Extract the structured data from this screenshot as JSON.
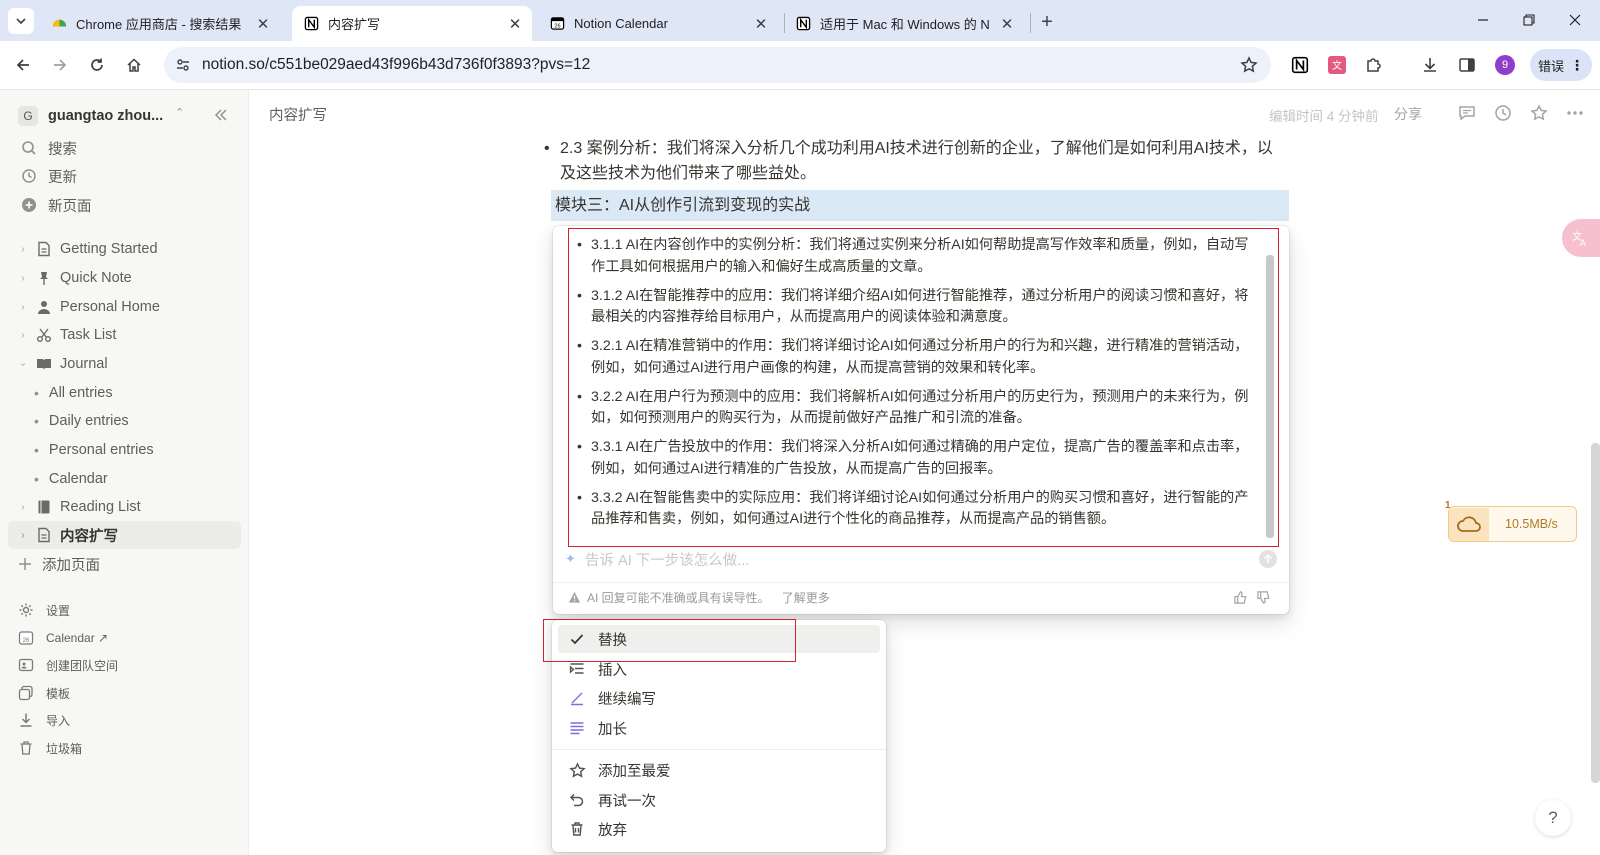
{
  "browser": {
    "tabs": [
      {
        "title": "Chrome 应用商店 - 搜索结果",
        "active": false
      },
      {
        "title": "内容扩写",
        "active": true
      },
      {
        "title": "Notion Calendar",
        "active": false
      },
      {
        "title": "适用于 Mac 和 Windows 的 N",
        "active": false
      }
    ],
    "url": "notion.so/c551be029aed43f996b43d736f0f3893?pvs=12",
    "profile_initial": "9",
    "error_label": "错误"
  },
  "sidebar": {
    "workspace_initial": "G",
    "workspace_name": "guangtao zhou...",
    "top_items": [
      "搜索",
      "更新",
      "新页面"
    ],
    "pages": [
      {
        "label": "Getting Started",
        "icon": "page-icon"
      },
      {
        "label": "Quick Note",
        "icon": "pin-icon"
      },
      {
        "label": "Personal Home",
        "icon": "person-icon"
      },
      {
        "label": "Task List",
        "icon": "scissors-icon"
      },
      {
        "label": "Journal",
        "icon": "book-icon"
      }
    ],
    "journal_children": [
      "All entries",
      "Daily entries",
      "Personal entries",
      "Calendar"
    ],
    "more_pages": [
      {
        "label": "Reading List",
        "icon": "book-icon"
      },
      {
        "label": "内容扩写",
        "icon": "page-icon",
        "selected": true
      }
    ],
    "add_page": "添加页面",
    "bottom_items": [
      "设置",
      "Calendar ↗",
      "创建团队空间",
      "模板",
      "导入",
      "垃圾箱"
    ]
  },
  "topbar": {
    "breadcrumb": "内容扩写",
    "edited": "编辑时间 4 分钟前",
    "share": "分享"
  },
  "content": {
    "bullet": "2.3 案例分析：我们将深入分析几个成功利用AI技术进行创新的企业，了解他们是如何利用AI技术，以及这些技术为他们带来了哪些益处。",
    "heading": "模块三：AI从创作引流到变现的实战"
  },
  "ai": {
    "results": [
      "3.1.1 AI在内容创作中的实例分析：我们将通过实例来分析AI如何帮助提高写作效率和质量，例如，自动写作工具如何根据用户的输入和偏好生成高质量的文章。",
      "3.1.2 AI在智能推荐中的应用：我们将详细介绍AI如何进行智能推荐，通过分析用户的阅读习惯和喜好，将最相关的内容推荐给目标用户，从而提高用户的阅读体验和满意度。",
      "3.2.1 AI在精准营销中的作用：我们将详细讨论AI如何通过分析用户的行为和兴趣，进行精准的营销活动，例如，如何通过AI进行用户画像的构建，从而提高营销的效果和转化率。",
      "3.2.2 AI在用户行为预测中的应用：我们将解析AI如何通过分析用户的历史行为，预测用户的未来行为，例如，如何预测用户的购买行为，从而提前做好产品推广和引流的准备。",
      "3.3.1 AI在广告投放中的作用：我们将深入分析AI如何通过精确的用户定位，提高广告的覆盖率和点击率，例如，如何通过AI进行精准的广告投放，从而提高广告的回报率。",
      "3.3.2 AI在智能售卖中的实际应用：我们将详细讨论AI如何通过分析用户的购买习惯和喜好，进行智能的产品推荐和售卖，例如，如何通过AI进行个性化的商品推荐，从而提高产品的销售额。"
    ],
    "prompt_placeholder": "告诉 AI 下一步该怎么做...",
    "disclaimer": "AI 回复可能不准确或具有误导性。",
    "learn_more": "了解更多"
  },
  "menu": {
    "items": [
      "替换",
      "插入",
      "继续编写",
      "加长"
    ],
    "secondary": [
      "添加至最爱",
      "再试一次",
      "放弃"
    ]
  },
  "widgets": {
    "speed_count": "1",
    "speed": "10.5MB/s",
    "help": "?"
  },
  "colors": {
    "highlight_box": "#d6202d",
    "heading_bg": "#dbe8f6",
    "tabbar_bg": "#dfe7f7"
  }
}
